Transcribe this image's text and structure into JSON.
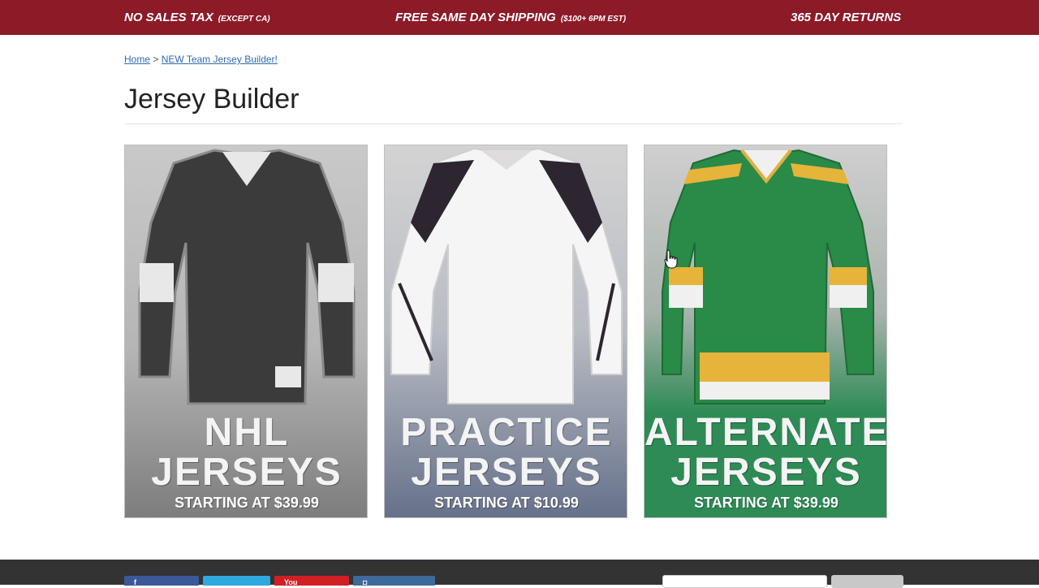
{
  "promo_bar": {
    "tax_label": "NO SALES TAX",
    "tax_note": "(EXCEPT CA)",
    "shipping_label": "FREE SAME DAY SHIPPING",
    "shipping_note": "($100+ 6PM EST)",
    "returns_label": "365 DAY RETURNS"
  },
  "breadcrumb": {
    "home": "Home",
    "separator": ">",
    "current": "NEW Team Jersey Builder!"
  },
  "page_title": "Jersey Builder",
  "cards": [
    {
      "line1": "NHL",
      "line2": "JERSEYS",
      "price": "STARTING AT $39.99",
      "jersey_color": "#3b3b3b"
    },
    {
      "line1": "PRACTICE",
      "line2": "JERSEYS",
      "price": "STARTING AT $10.99",
      "jersey_color": "#f5f5f5"
    },
    {
      "line1": "ALTERNATE",
      "line2": "JERSEYS",
      "price": "STARTING AT $39.99",
      "jersey_color": "#2a8a48"
    }
  ],
  "footer": {
    "youtube_label": "You"
  },
  "colors": {
    "promo_bar": "#8c1a27",
    "footer": "#333333",
    "facebook": "#3b5998",
    "twitter": "#2ea9e0",
    "youtube": "#d21f24",
    "instagram": "#3e6a99"
  }
}
